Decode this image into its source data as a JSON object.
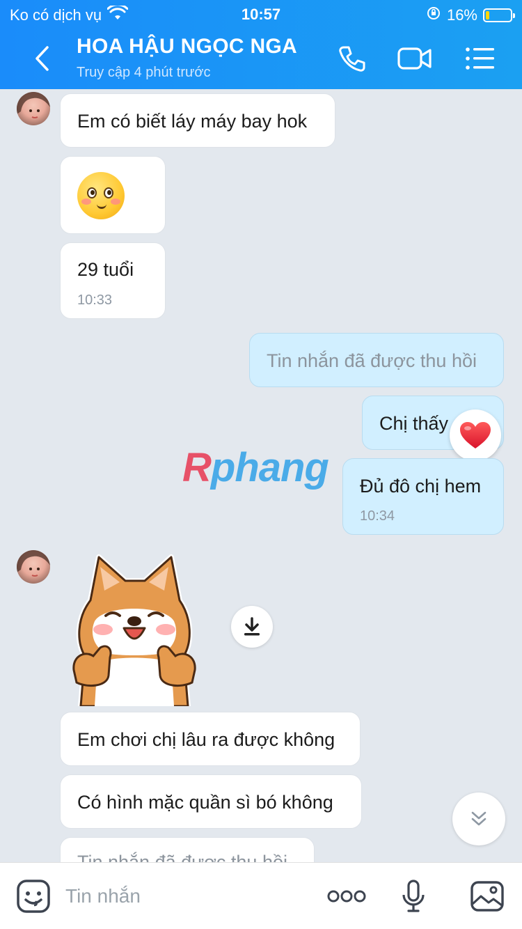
{
  "status_bar": {
    "carrier": "Ko có dịch vụ",
    "time": "10:57",
    "battery": "16%",
    "battery_level": 0.16
  },
  "header": {
    "title": "HOA HẬU NGỌC NGA",
    "subtitle": "Truy cập 4 phút trước"
  },
  "messages": {
    "m1": {
      "text": "Em có biết láy máy bay hok"
    },
    "m3": {
      "text": "29 tuổi",
      "time": "10:33"
    },
    "m4": {
      "text": "Tin nhắn đã được thu hồi"
    },
    "m5": {
      "text": "Chị thấy"
    },
    "m6": {
      "text": "Đủ đô chị hem",
      "time": "10:34"
    },
    "m8": {
      "text": "Em chơi chị lâu ra được không"
    },
    "m9": {
      "text": "Có hình mặc quần sì bó không"
    },
    "m10": {
      "text": "Tin nhắn đã được thu hồi"
    }
  },
  "watermark": {
    "first": "R",
    "rest": "phang"
  },
  "input": {
    "placeholder": "Tin nhắn"
  },
  "colors": {
    "header": "#1a8cfa",
    "bubble_out": "#d1efff",
    "bubble_in": "#ffffff",
    "background": "#e3e8ee"
  }
}
